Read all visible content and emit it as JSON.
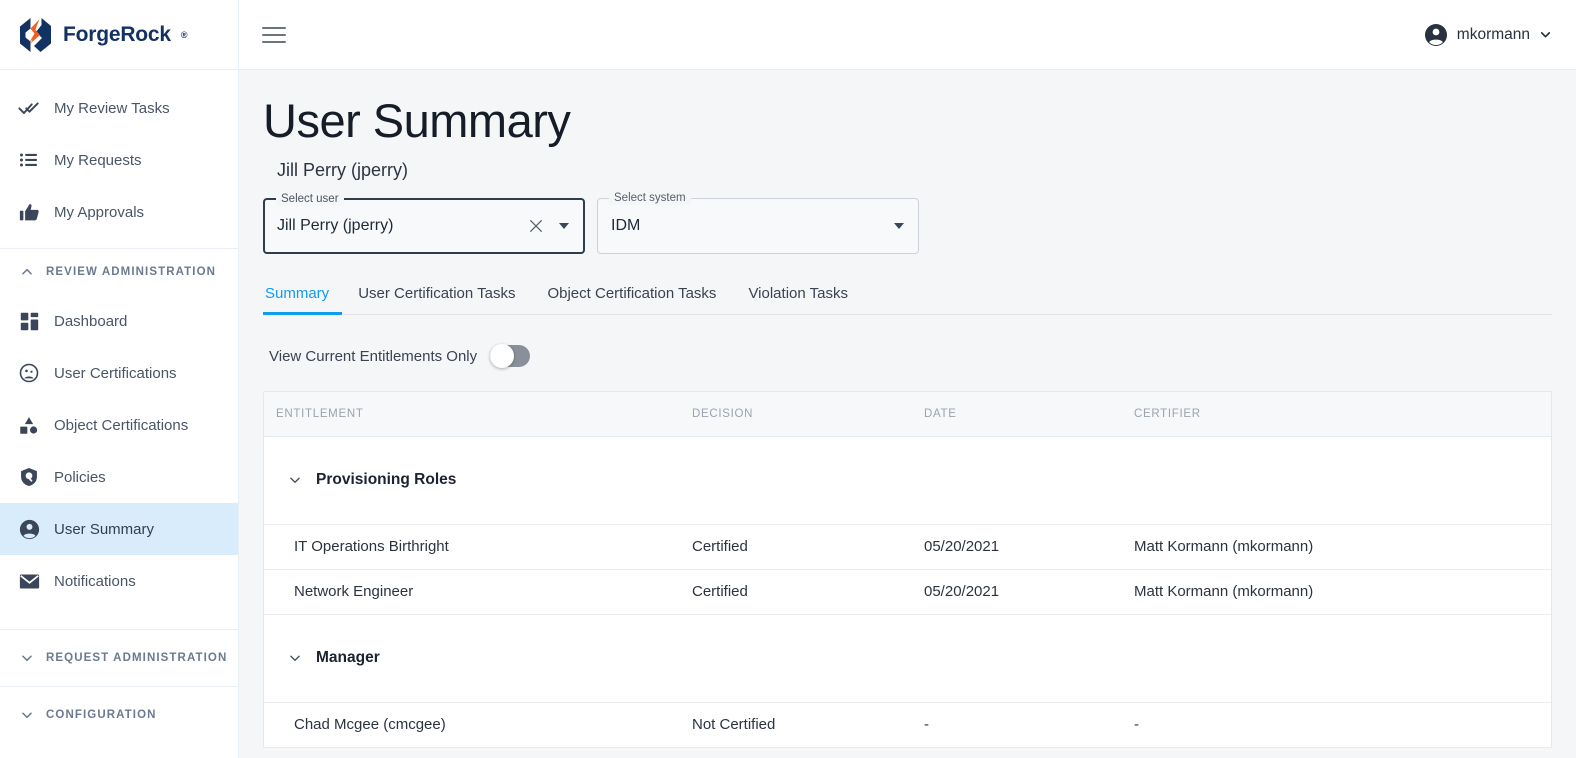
{
  "brand": {
    "name": "ForgeRock",
    "trademark": "®",
    "logo_icon": "forgerock-logo"
  },
  "sidebar": {
    "primary_items": [
      {
        "label": "My Review Tasks",
        "icon": "double-check-icon"
      },
      {
        "label": "My Requests",
        "icon": "list-icon"
      },
      {
        "label": "My Approvals",
        "icon": "thumbs-up-icon"
      }
    ],
    "groups": [
      {
        "label": "REVIEW ADMINISTRATION",
        "expanded": true,
        "caret_icon": "chevron-up-icon",
        "items": [
          {
            "label": "Dashboard",
            "icon": "dashboard-icon",
            "active": false
          },
          {
            "label": "User Certifications",
            "icon": "user-certifications-icon",
            "active": false
          },
          {
            "label": "Object Certifications",
            "icon": "object-certifications-icon",
            "active": false
          },
          {
            "label": "Policies",
            "icon": "shield-search-icon",
            "active": false
          },
          {
            "label": "User Summary",
            "icon": "user-icon",
            "active": true
          },
          {
            "label": "Notifications",
            "icon": "envelope-icon",
            "active": false
          }
        ]
      },
      {
        "label": "REQUEST ADMINISTRATION",
        "expanded": false,
        "caret_icon": "chevron-down-icon",
        "items": []
      },
      {
        "label": "CONFIGURATION",
        "expanded": false,
        "caret_icon": "chevron-down-icon",
        "items": []
      }
    ]
  },
  "topbar": {
    "menu_icon": "hamburger-icon",
    "user": {
      "name": "mkormann",
      "avatar_icon": "account-circle-icon",
      "caret_icon": "chevron-down-icon"
    }
  },
  "page": {
    "title": "User Summary",
    "subtitle": "Jill Perry (jperry)"
  },
  "filters": {
    "select_user": {
      "legend": "Select user",
      "value": "Jill Perry (jperry)",
      "clear_icon": "close-icon",
      "dropdown_icon": "caret-down-icon"
    },
    "select_system": {
      "legend": "Select system",
      "value": "IDM",
      "dropdown_icon": "caret-down-icon"
    }
  },
  "tabs": [
    {
      "label": "Summary",
      "active": true
    },
    {
      "label": "User Certification Tasks",
      "active": false
    },
    {
      "label": "Object Certification Tasks",
      "active": false
    },
    {
      "label": "Violation Tasks",
      "active": false
    }
  ],
  "toggle": {
    "label": "View Current Entitlements Only",
    "on": false
  },
  "table": {
    "columns": [
      "ENTITLEMENT",
      "DECISION",
      "DATE",
      "CERTIFIER"
    ],
    "sections": [
      {
        "title": "Provisioning Roles",
        "chevron_icon": "chevron-down-icon",
        "rows": [
          {
            "entitlement": "IT Operations Birthright",
            "decision": "Certified",
            "date": "05/20/2021",
            "certifier": "Matt Kormann (mkormann)"
          },
          {
            "entitlement": "Network Engineer",
            "decision": "Certified",
            "date": "05/20/2021",
            "certifier": "Matt Kormann (mkormann)"
          }
        ]
      },
      {
        "title": "Manager",
        "chevron_icon": "chevron-down-icon",
        "rows": [
          {
            "entitlement": "Chad Mcgee (cmcgee)",
            "decision": "Not Certified",
            "date": "-",
            "certifier": "-"
          }
        ]
      }
    ]
  },
  "colors": {
    "accent_blue": "#109cf1",
    "brand_navy": "#123263",
    "brand_orange": "#f3601f",
    "active_nav_bg": "#d9ecfb",
    "page_bg": "#f4f6f8",
    "text_dark": "#161d27"
  }
}
